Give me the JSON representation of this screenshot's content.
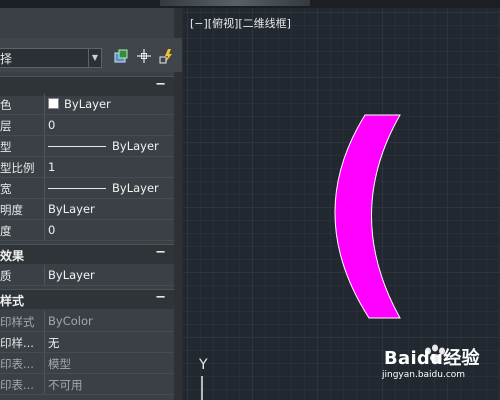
{
  "view": {
    "label": "[−][俯视][二维线框]"
  },
  "axis": {
    "y_label": "Y"
  },
  "palette": {
    "selector": "择",
    "sections": {
      "general_collapse": "−",
      "effects_title": "效果",
      "effects_collapse": "−",
      "plotstyle_title": "样式",
      "plotstyle_collapse": "−"
    },
    "general": [
      {
        "key": "色",
        "value": "ByLayer",
        "swatch": "#ffffff"
      },
      {
        "key": "层",
        "value": "0"
      },
      {
        "key": "型",
        "value": "ByLayer",
        "line": true
      },
      {
        "key": "型比例",
        "value": "1"
      },
      {
        "key": "宽",
        "value": "ByLayer",
        "line": true
      },
      {
        "key": "明度",
        "value": "ByLayer"
      },
      {
        "key": "度",
        "value": "0"
      }
    ],
    "effects": [
      {
        "key": "质",
        "value": "ByLayer"
      }
    ],
    "plotstyle": [
      {
        "key": "印样式",
        "value": "ByColor"
      },
      {
        "key": "印样...",
        "value": "无"
      },
      {
        "key": "印表...",
        "value": "模型"
      },
      {
        "key": "印表...",
        "value": "不可用"
      }
    ]
  },
  "watermark": {
    "main": "Baidu经验",
    "sub": "jingyan.baidu.com"
  },
  "colors": {
    "arc": "#ff00ff",
    "canvas": "#212830",
    "grid": "#2e3640",
    "grid_major": "#38414c"
  }
}
